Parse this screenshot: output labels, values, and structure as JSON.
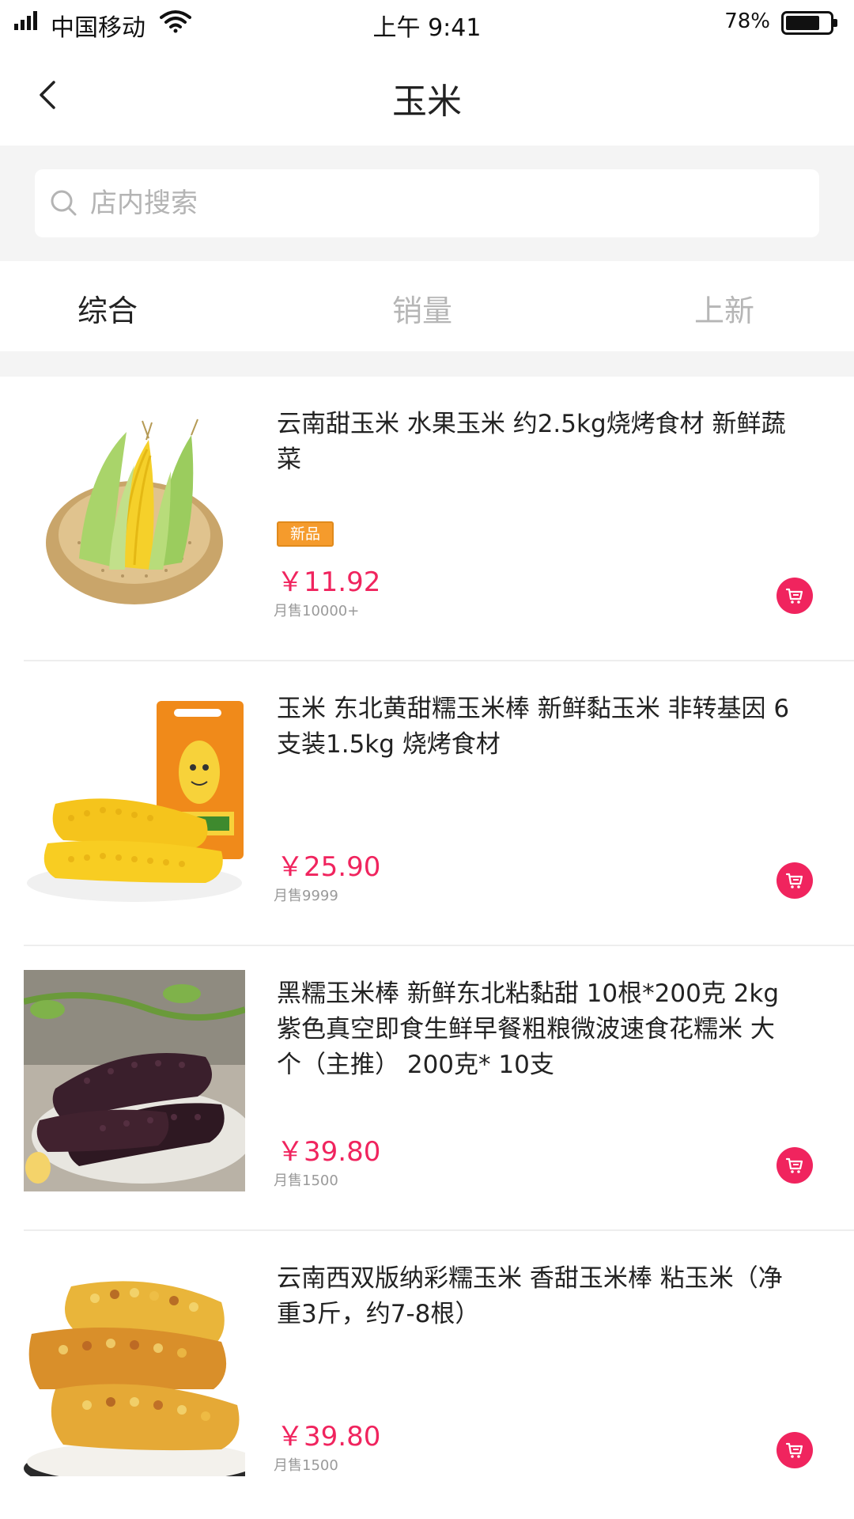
{
  "status_bar": {
    "carrier": "中国移动",
    "time": "上午 9:41",
    "battery_percent_label": "78%",
    "battery_level": 0.78
  },
  "nav": {
    "back_icon": "chevron-left-icon",
    "title": "玉米"
  },
  "search": {
    "icon": "search-icon",
    "placeholder": "店内搜索",
    "value": ""
  },
  "tabs": [
    {
      "label": "综合",
      "active": true
    },
    {
      "label": "销量",
      "active": false
    },
    {
      "label": "上新",
      "active": false
    }
  ],
  "colors": {
    "price": "#f0245e",
    "cart_button": "#f0245e",
    "badge": "#f59b2c"
  },
  "products": [
    {
      "title": "云南甜玉米 水果玉米 约2.5kg烧烤食材 新鲜蔬菜",
      "badge": "新品",
      "price": "￥11.92",
      "sold": "月售10000+",
      "image": "sweet-corn-in-basket"
    },
    {
      "title": "玉米 东北黄甜糯玉米棒 新鲜黏玉米 非转基因 6支装1.5kg 烧烤食材",
      "price": "￥25.90",
      "sold": "月售9999",
      "image": "yellow-waxy-corn-with-package"
    },
    {
      "title": " 黑糯玉米棒 新鲜东北粘黏甜 10根*200克 2kg紫色真空即食生鲜早餐粗粮微波速食花糯米 大个（主推） 200克* 10支",
      "price": "￥39.80",
      "sold": "月售1500",
      "image": "black-waxy-corn-on-plate"
    },
    {
      "title": "云南西双版纳彩糯玉米 香甜玉米棒 粘玉米（净重3斤，约7-8根）",
      "price": "￥39.80",
      "sold": "月售1500",
      "image": "colorful-waxy-corn"
    }
  ]
}
